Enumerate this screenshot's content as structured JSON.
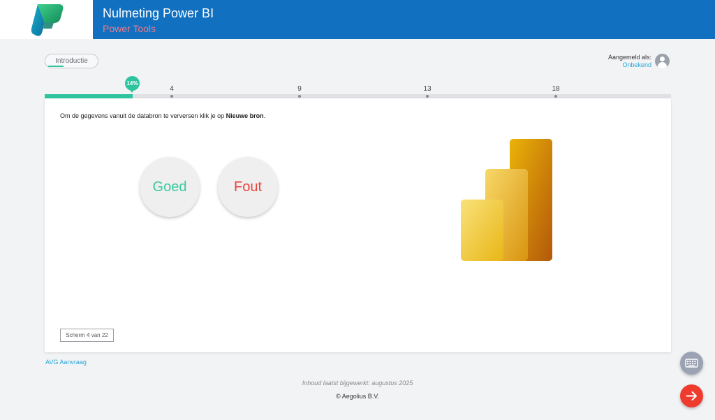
{
  "header": {
    "title": "Nulmeting Power BI",
    "subtitle": "Power Tools",
    "logo_icon": "power-tools-logo-icon"
  },
  "intro_tab": {
    "label": "Introductie"
  },
  "user": {
    "label": "Aangemeld als:",
    "value": "Onbekend",
    "icon": "user-avatar-icon"
  },
  "progress": {
    "percent": 14,
    "badge": "14%",
    "ticks": [
      "4",
      "9",
      "13",
      "18"
    ]
  },
  "question": {
    "text_prefix": "Om de gegevens vanuit de databron te verversen klik je op ",
    "text_bold": "Nieuwe bron",
    "text_suffix": "."
  },
  "answers": {
    "correct": "Goed",
    "wrong": "Fout"
  },
  "screen_counter": "Scherm 4 van 22",
  "footer": {
    "avg_link": "AVG Aanvraag",
    "updated": "Inhoud laatst bijgewerkt: augustus 2025",
    "copyright": "© Aegolius B.V."
  },
  "fabs": {
    "keyboard_icon": "keyboard-icon",
    "next_icon": "arrow-right-icon"
  },
  "colors": {
    "header_bg": "#1170c0",
    "accent_green": "#2ec4a0",
    "wrong_red": "#e8453c",
    "link_blue": "#2aa7d8",
    "next_red": "#ef3b2e"
  }
}
